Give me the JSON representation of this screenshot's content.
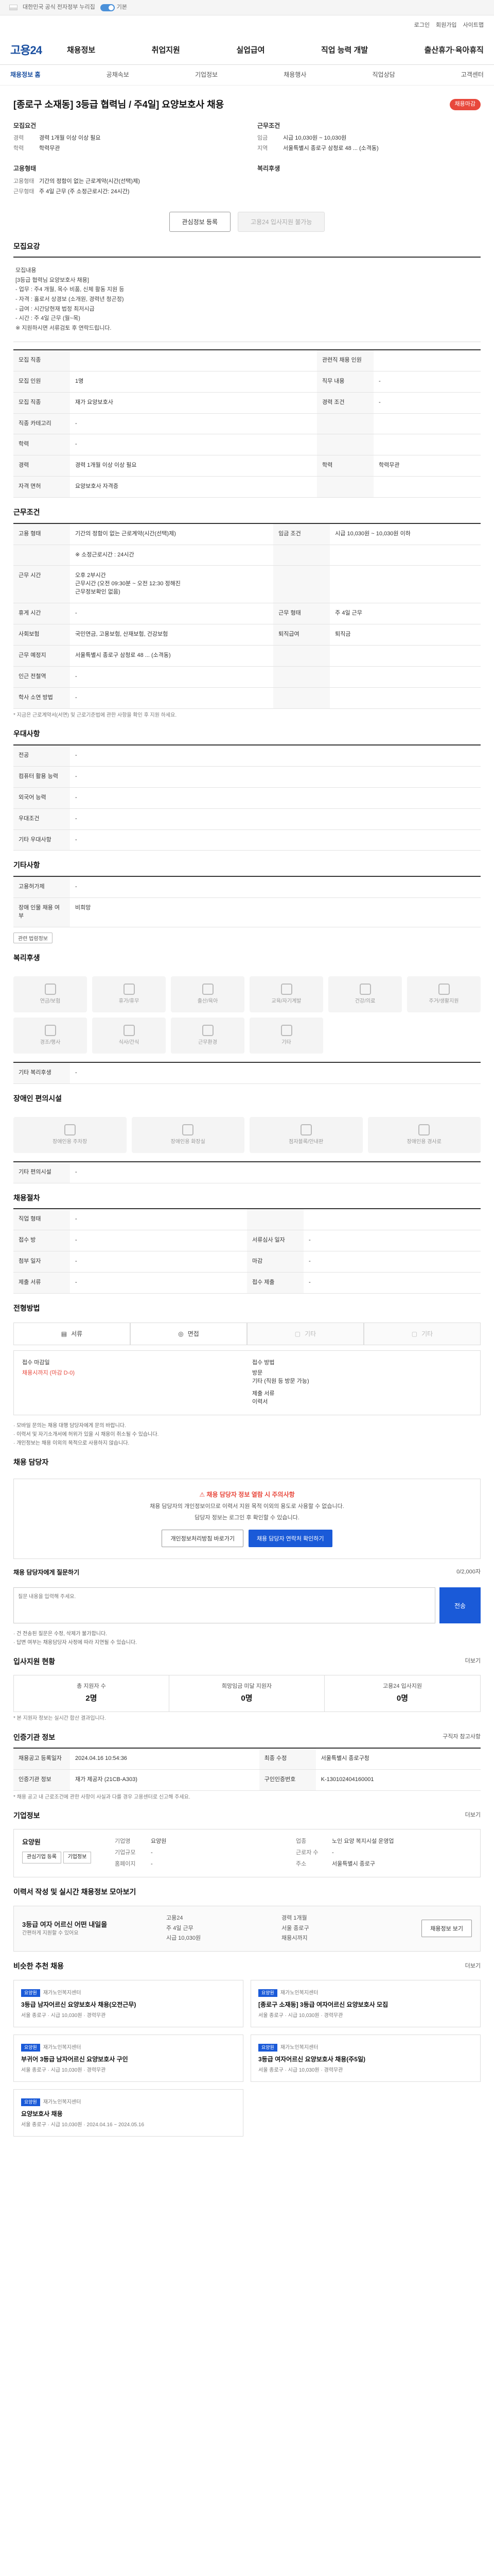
{
  "topbar": {
    "notice": "대한민국 공식 전자정부 누리집",
    "toggle_label": "기본"
  },
  "util": {
    "links": [
      "로그인",
      "회원가입",
      "사이트맵"
    ]
  },
  "header": {
    "logo": "고용24",
    "gnb": [
      "채용정보",
      "취업지원",
      "실업급여",
      "직업 능력 개발",
      "출산휴가·육아휴직"
    ]
  },
  "subnav": [
    "채용정보 홈",
    "공채속보",
    "기업정보",
    "채용행사",
    "직업상담",
    "고객센터"
  ],
  "job": {
    "title": "[종로구 소재동] 3등급 협력님 / 주4일] 요양보호사 채용",
    "badge": "채용마감",
    "summary": {
      "left_title": "모집요건",
      "left": [
        {
          "k": "경력",
          "v": "경력 1개월 이상 이상 필요"
        },
        {
          "k": "학력",
          "v": "학력무관"
        }
      ],
      "right_title": "근무조건",
      "right": [
        {
          "k": "임금",
          "v": "시급 10,030원 ~ 10,030원"
        },
        {
          "k": "지역",
          "v": "서울특별시 종로구 삼청로 48 ... (소격동)"
        }
      ],
      "left2_title": "고용형태",
      "left2": [
        {
          "k": "고용형태",
          "v": "기간의 정함이 없는 근로계약(시간(선택)제)"
        },
        {
          "k": "근무형태",
          "v": "주 4일 근무 (주 소정근로시간: 24시간)"
        }
      ],
      "right2_title": "복리후생",
      "right2": []
    },
    "buttons": {
      "scrap": "관심정보 등록",
      "apply": "고용24 입사지원 불가능"
    }
  },
  "recruit_section": {
    "title": "모집요강",
    "note": "모집내용\n[3등급 협력님 요양보호사 채용]\n- 업무 : 주4 개월, 목수 비품, 신체 활동 지원 등\n- 자격 : 홀로서 상경보 (소개원, 경력년 청곤정)\n- 급여 : 시간당현재 법정 최저시급\n- 시간 : 주 4일 근무 (월~목)\n※ 지원하시면 서류검토 후 연락드립니다."
  },
  "recruit_table": [
    {
      "k": "모집 직종",
      "v": "",
      "k2": "관련직 채용 인원",
      "v2": ""
    },
    {
      "k": "모집 인원",
      "v": "1명",
      "k2": "직무 내용",
      "v2": "-"
    },
    {
      "k": "모집 직종",
      "v": "재가 요양보호사",
      "k2": "경력 조건",
      "v2": "-"
    },
    {
      "k": "직종 카테고리",
      "v": "-",
      "k2": "",
      "v2": ""
    },
    {
      "k": "학력",
      "v": "-",
      "k2": "",
      "v2": ""
    },
    {
      "k": "경력",
      "v": "경력 1개월 이상 이상 필요",
      "k2": "학력",
      "v2": "학력무관"
    },
    {
      "k": "자격 면허",
      "v": "요양보호사 자격증",
      "k2": "",
      "v2": ""
    }
  ],
  "work_section": {
    "title": "근무조건",
    "rows": [
      {
        "k": "고용 형태",
        "v": "기간의 정함이 없는 근로계약(시간(선택)제)",
        "k2": "임금 조건",
        "v2": "시급 10,030원 ~ 10,030원 이하"
      },
      {
        "k": "",
        "v": "※ 소정근로시간 : 24시간",
        "k2": "",
        "v2": ""
      },
      {
        "k": "근무 시간",
        "v": "오후 2부시간\n근무시간 (오전 09:30분 ~ 오전 12:30 정해진\n근무정보확인 없음)",
        "k2": "",
        "v2": ""
      },
      {
        "k": "휴게 시간",
        "v": "-",
        "k2": "근무 형태",
        "v2": "주 4일 근무"
      },
      {
        "k": "사회보험",
        "v": "국민연금, 고용보험, 산재보험, 건강보험",
        "k2": "퇴직급여",
        "v2": "퇴직금"
      },
      {
        "k": "근무 예정지",
        "v": "서울특별시 종로구 삼청로 48 ... (소격동)",
        "k2": "",
        "v2": ""
      },
      {
        "k": "인근 전철역",
        "v": "-",
        "k2": "",
        "v2": ""
      },
      {
        "k": "학사 소연 방법",
        "v": "-",
        "k2": "",
        "v2": ""
      }
    ],
    "map_button": "지도 보기",
    "footnote": "* 지금은 근로계약서(서면) 및 근로기준법에 관한 사항을 확인 후 지원 하세요."
  },
  "pref_section": {
    "title": "우대사항",
    "rows": [
      {
        "k": "전공",
        "v": "-"
      },
      {
        "k": "컴퓨터 활용 능력",
        "v": "-"
      },
      {
        "k": "외국어 능력",
        "v": "-"
      },
      {
        "k": "우대조건",
        "v": "-"
      },
      {
        "k": "기타 우대사항",
        "v": "-"
      }
    ]
  },
  "etc_section": {
    "title": "기타사항",
    "rows": [
      {
        "k": "고용허가제",
        "v": "-"
      },
      {
        "k": "장애 인물 채용 여부",
        "v": "비희망"
      }
    ],
    "link": "관련 법령정보"
  },
  "welfare_section": {
    "title": "복리후생",
    "items": [
      "연금/보험",
      "휴가/휴무",
      "출산/육아",
      "교육/자기계발",
      "건강/의료",
      "주거/생활지원",
      "경조/행사",
      "식사/간식",
      "근무환경",
      "기타"
    ],
    "extra_label": "기타 복리후생",
    "extra_value": "-"
  },
  "disabled_section": {
    "title": "장애인 편의시설",
    "items": [
      "장애인용 주차장",
      "장애인용 화장실",
      "점자블록/안내판",
      "장애인용 경사로"
    ],
    "extra_label": "기타 편의시설",
    "extra_value": "-"
  },
  "selection_section": {
    "title": "채용절차",
    "rows": [
      {
        "k": "직업 형태",
        "v": "-",
        "k2": "",
        "v2": ""
      },
      {
        "k": "접수 방",
        "v": "-",
        "k2": "서류심사 일자",
        "v2": "-"
      },
      {
        "k": "첨부 일자",
        "v": "-",
        "k2": "마감",
        "v2": "-"
      },
      {
        "k": "제출 서류",
        "v": "-",
        "k2": "접수 제출",
        "v2": "-"
      }
    ]
  },
  "apply_method": {
    "title": "전형방법",
    "steps": [
      "서류",
      "면접",
      "기타",
      "기타"
    ],
    "box": {
      "left_label": "접수 마감일",
      "left_value": "채용시까지 (마감 D-0)",
      "right_label": "접수 방법",
      "right_lines": [
        "방문",
        "기타 (직원 등 방문 가능)",
        "제출 서류",
        "이력서"
      ]
    },
    "bullets": "· 모바일 문의는 채용 대행 담당자에게 문의 바랍니다.\n· 이력서 및 자기소개서에 허위가 있을 시 채용이 취소될 수 있습니다.\n· 개인정보는 채용 이외의 목적으로 사용하지 않습니다."
  },
  "contact_section": {
    "title": "채용 담당자",
    "warn": "채용 담당자 정보 열람 시 주의사항",
    "desc1": "채용 담당자의 개인정보이므로 이력서 지원 목적 이외의 용도로 사용할 수 없습니다.",
    "desc2": "담당자 정보는 로그인 후 확인할 수 있습니다.",
    "btn1": "개인정보처리방침 바로가기",
    "btn2": "채용 담당자 연락처 확인하기"
  },
  "inquiry_section": {
    "title": "채용 담당자에게 질문하기",
    "counter": "0/2,000자",
    "placeholder": "질문 내용을 입력해 주세요.",
    "send": "전송",
    "notes": "· 건 전송된 질문은 수정, 삭제가 불가합니다.\n· 답변 여부는 채용담당자 사정에 따라 지연될 수 있습니다."
  },
  "stats_section": {
    "title": "입사지원 현황",
    "more": "더보기",
    "items": [
      {
        "label": "총 지원자 수",
        "value": "2명"
      },
      {
        "label": "희망임금 미달 지원자",
        "value": "0명"
      },
      {
        "label": "고용24 입사지원",
        "value": "0명"
      }
    ],
    "note": "* 본 지원자 정보는 실시간 합산 결과입니다."
  },
  "reg_section": {
    "title": "인증기관 정보",
    "more": "구직자 참고사항",
    "rows": [
      {
        "k": "채용공고 등록일자",
        "v": "2024.04.16 10:54:36",
        "k2": "최종 수정",
        "v2": "서울특별시 종로구청"
      },
      {
        "k": "인증기관 정보",
        "v": "재가 제공자 (21CB-A303)",
        "k2": "구인인증번호",
        "v2": "K-130102404160001"
      }
    ],
    "footnote": "* 채용 공고 내 근로조건에 관한 사항이 사실과 다를 경우 고용센터로 신고해 주세요."
  },
  "company_section": {
    "title": "기업정보",
    "more": "더보기",
    "name": "요양원",
    "btn_a": "관심기업 등록",
    "btn_b": "기업정보",
    "info": [
      {
        "k": "기업명",
        "v": "요양원"
      },
      {
        "k": "업종",
        "v": "노인 요양 복지시설 운영업"
      },
      {
        "k": "기업규모",
        "v": "-"
      },
      {
        "k": "근로자 수",
        "v": "-"
      },
      {
        "k": "홈페이지",
        "v": "-"
      },
      {
        "k": "주소",
        "v": "서울특별시 종로구"
      }
    ]
  },
  "banner_section": {
    "title": "이력서 작성 및 실시간 채용정보 모아보기",
    "line1": "3등급 여자 어르신 어떤 내일을",
    "line2": "간편하게 지원할 수 있어요",
    "items": [
      "고용24",
      "경력 1개월",
      "주 4일 근무",
      "서울 종로구",
      "시급 10,030원",
      "채용시까지"
    ],
    "btn": "채용정보 보기"
  },
  "recommend_section": {
    "title": "비슷한 추천 채용",
    "more": "더보기",
    "cards": [
      {
        "tag": "요양원",
        "company": "재가노인복지센터",
        "title": "3등급 남자어르신 요양보호사 채용(오전근무)",
        "meta": "서울 종로구 · 시급 10,030원 · 경력무관"
      },
      {
        "tag": "요양원",
        "company": "재가노인복지센터",
        "title": "[종로구 소재동] 3등급 여자어르신 요양보호사 모집",
        "meta": "서울 종로구 · 시급 10,030원 · 경력무관"
      },
      {
        "tag": "요양원",
        "company": "재가노인복지센터",
        "title": "부귀어 3등급 남자어르신 요양보호사 구인",
        "meta": "서울 종로구 · 시급 10,030원 · 경력무관"
      },
      {
        "tag": "요양원",
        "company": "재가노인복지센터",
        "title": "3등급 여자어르신 요양보호사 채용(주5일)",
        "meta": "서울 종로구 · 시급 10,030원 · 경력무관"
      },
      {
        "tag": "요양원",
        "company": "재가노인복지센터",
        "title": "요양보호사 채용",
        "meta": "서울 종로구 · 시급 10,030원 · 2024.04.16 ~ 2024.05.16"
      }
    ]
  }
}
